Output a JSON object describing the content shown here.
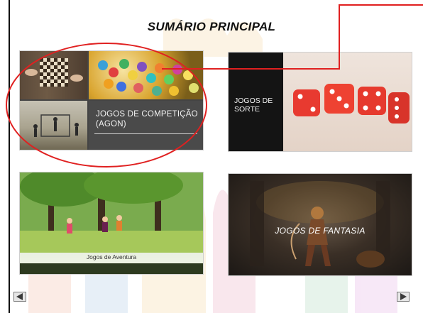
{
  "title": "SUMÁRIO PRINCIPAL",
  "tiles": {
    "competition": {
      "label": "JOGOS DE COMPETIÇÃO (AGON)"
    },
    "luck": {
      "label_line1": "JOGOS DE",
      "label_line2": "SORTE"
    },
    "adventure": {
      "label": "Jogos de Aventura"
    },
    "fantasy": {
      "label": "JOGOS DE FANTASIA"
    }
  },
  "annotation": {
    "color": "#e02020"
  },
  "icons": {
    "prev": "triangle-left-icon",
    "next": "triangle-right-icon"
  }
}
